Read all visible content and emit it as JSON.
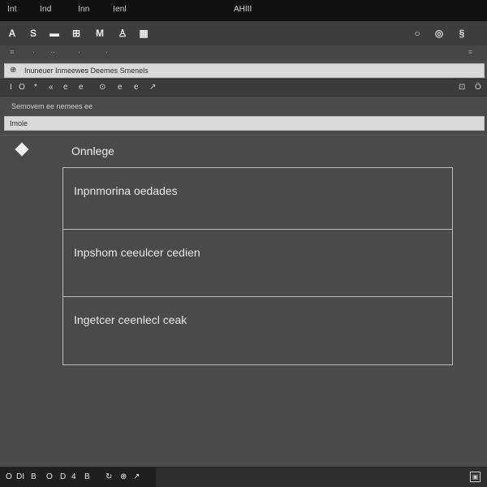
{
  "menubar": {
    "items": [
      "Int",
      "Ind",
      "Inn",
      "Ienl"
    ],
    "app_title": "AHIII"
  },
  "toolbar": {
    "left_tools": [
      {
        "glyph": "A",
        "icon": "text-icon"
      },
      {
        "glyph": "S",
        "icon": "select-icon"
      },
      {
        "glyph": "▬",
        "icon": "rectangle-icon"
      },
      {
        "glyph": "⊞",
        "icon": "grid-icon"
      },
      {
        "glyph": "M",
        "icon": "measure-icon"
      },
      {
        "glyph": "♙",
        "icon": "object-icon"
      },
      {
        "glyph": "▦",
        "icon": "table-icon"
      }
    ],
    "right_tools": [
      {
        "glyph": "○",
        "icon": "circle-icon"
      },
      {
        "glyph": "◎",
        "icon": "target-icon"
      },
      {
        "glyph": "§",
        "icon": "settings-icon"
      }
    ]
  },
  "subtoolbar": {
    "items": [
      "≡",
      "·",
      "··",
      "·",
      "·"
    ],
    "right_items": [
      "≡"
    ]
  },
  "address": {
    "icon": "⊕",
    "text": "Inuneuer Inmeewes Deemes Smenels"
  },
  "iconstrip": {
    "left": [
      "I",
      "O",
      "*",
      "«",
      "e",
      "e",
      "⊙",
      "e",
      "e",
      "↗"
    ],
    "right": [
      "⊡",
      "Ö"
    ]
  },
  "small_label": "Semovem ee nemees ee",
  "input": {
    "value": "Imole"
  },
  "section": {
    "title": "Onnlege"
  },
  "options": [
    {
      "label": "Inpnmorina oedades"
    },
    {
      "label": "Inpshom ceeulcer cedien"
    },
    {
      "label": "Ingetcer ceenlecl ceak"
    }
  ],
  "bottombar": {
    "left_icons": [
      "O",
      "DI",
      "B",
      "O",
      "D",
      "4",
      "B",
      "↻",
      "⊕",
      "↗"
    ],
    "right_icon": "▣"
  }
}
